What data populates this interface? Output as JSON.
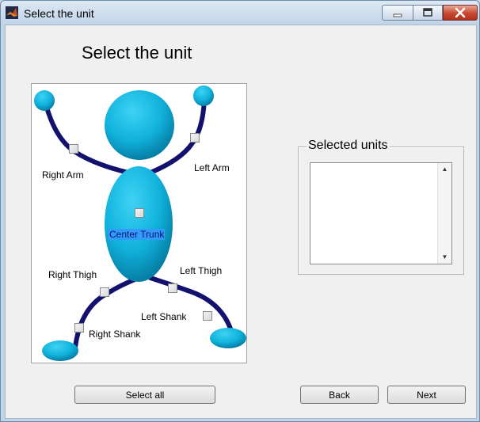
{
  "window": {
    "title": "Select the unit"
  },
  "dialog": {
    "heading": "Select the unit",
    "body_parts": [
      {
        "label": "Right Arm",
        "checked": false,
        "selected": false
      },
      {
        "label": "Left Arm",
        "checked": false,
        "selected": false
      },
      {
        "label": "Center Trunk",
        "checked": false,
        "selected": true
      },
      {
        "label": "Right Thigh",
        "checked": false,
        "selected": false
      },
      {
        "label": "Left Thigh",
        "checked": false,
        "selected": false
      },
      {
        "label": "Left Shank",
        "checked": false,
        "selected": false
      },
      {
        "label": "Right Shank",
        "checked": false,
        "selected": false
      }
    ],
    "selected_units": {
      "title": "Selected units",
      "items": []
    },
    "buttons": {
      "select_all": "Select all",
      "back": "Back",
      "next": "Next"
    }
  },
  "colors": {
    "body": "#0bb0d8",
    "limb": "#1a1a78",
    "selection": "#3399ff"
  },
  "icons": {
    "app": "matlab-icon",
    "minimize": "minimize-icon",
    "maximize": "maximize-icon",
    "close": "close-icon"
  }
}
